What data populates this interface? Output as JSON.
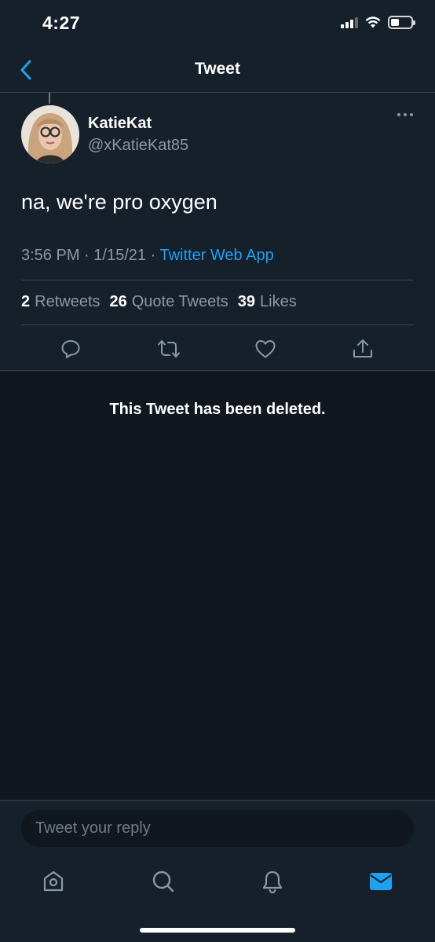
{
  "status_bar": {
    "time": "4:27"
  },
  "header": {
    "title": "Tweet"
  },
  "tweet": {
    "display_name": "KatieKat",
    "handle": "@xKatieKat85",
    "text": "na, we're pro oxygen",
    "time": "3:56 PM",
    "date": "1/15/21",
    "source": "Twitter Web App",
    "separator": "·",
    "stats": {
      "retweets_count": "2",
      "retweets_label": "Retweets",
      "quotes_count": "26",
      "quotes_label": "Quote Tweets",
      "likes_count": "39",
      "likes_label": "Likes"
    },
    "actions": [
      "reply-icon",
      "retweet-icon",
      "like-icon",
      "share-icon"
    ]
  },
  "notice": {
    "deleted": "This Tweet has been deleted."
  },
  "reply": {
    "placeholder": "Tweet your reply"
  },
  "tab_bar": {
    "tabs": [
      "home-icon",
      "search-icon",
      "notifications-icon",
      "messages-icon"
    ],
    "active_color": "#1da1f2",
    "inactive_color": "#8899a6"
  },
  "colors": {
    "background": "#15202b",
    "accent": "#1da1f2",
    "secondary_text": "#8899a6"
  }
}
